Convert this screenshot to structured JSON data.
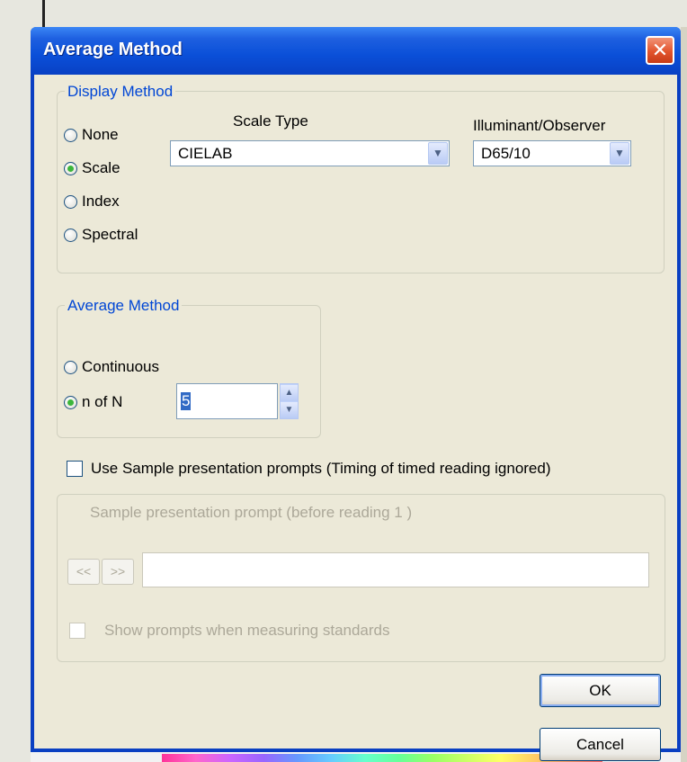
{
  "dialog": {
    "title": "Average Method",
    "close_label": "✕"
  },
  "display_method": {
    "legend": "Display Method",
    "options": [
      "None",
      "Scale",
      "Index",
      "Spectral"
    ],
    "selected": "Scale",
    "scale_type": {
      "label": "Scale Type",
      "value": "CIELAB"
    },
    "illuminant": {
      "label": "Illuminant/Observer",
      "value": "D65/10"
    }
  },
  "average_method": {
    "legend": "Average Method",
    "options": [
      "Continuous",
      "n of N"
    ],
    "selected": "n of N",
    "n_value": "5"
  },
  "prompts": {
    "use_label": "Use Sample presentation prompts (Timing of timed reading ignored)",
    "use_checked": false,
    "group_title": "Sample presentation prompt (before reading 1 )",
    "prev_label": "<<",
    "next_label": ">>",
    "prompt_value": "",
    "show_label": "Show prompts when measuring standards",
    "show_checked": false
  },
  "buttons": {
    "ok": "OK",
    "cancel": "Cancel"
  }
}
